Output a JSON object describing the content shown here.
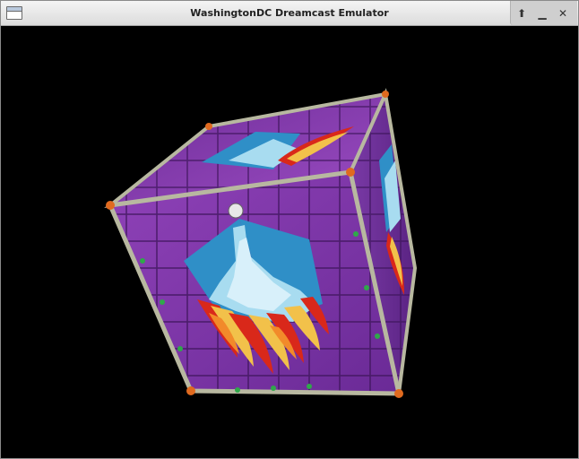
{
  "window": {
    "title": "WashingtonDC Dreamcast Emulator",
    "icon": "window-icon",
    "controls": [
      {
        "name": "maximize-button",
        "icon": "arrow-up-icon",
        "glyph": "⬆"
      },
      {
        "name": "minimize-button",
        "icon": "minimize-icon",
        "glyph": "▁"
      },
      {
        "name": "close-button",
        "icon": "close-icon",
        "glyph": "✕"
      }
    ]
  },
  "viewport": {
    "background": "#000000",
    "scene": "rotating-stained-glass-cube",
    "colors": {
      "purple": "#8a3fb0",
      "deep_purple": "#5c2185",
      "blue": "#2f8fc7",
      "ice": "#a8dcf0",
      "flame_red": "#d9281a",
      "flame_yellow": "#f2c14a",
      "frame": "#b8b8a0",
      "rivet": "#e06a1f"
    }
  }
}
